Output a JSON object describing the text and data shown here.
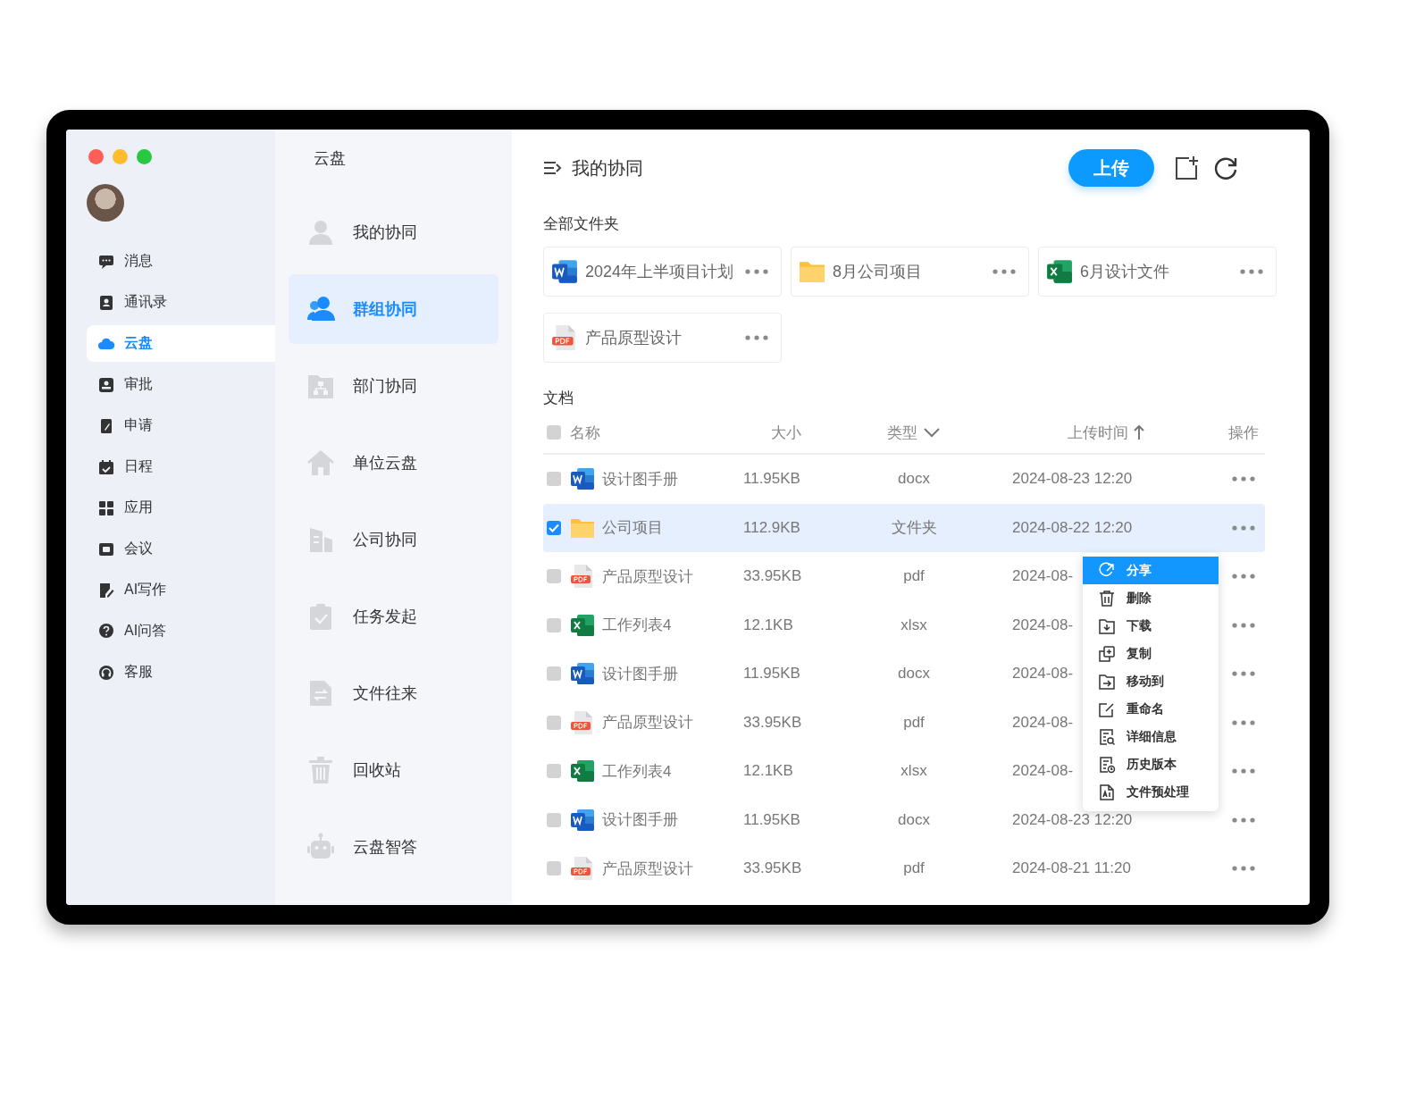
{
  "nav": {
    "items": [
      {
        "label": "消息",
        "kind": "chat",
        "selected": false
      },
      {
        "label": "通讯录",
        "kind": "contacts",
        "selected": false
      },
      {
        "label": "云盘",
        "kind": "cloud",
        "selected": true
      },
      {
        "label": "审批",
        "kind": "stamp",
        "selected": false
      },
      {
        "label": "申请",
        "kind": "pen",
        "selected": false
      },
      {
        "label": "日程",
        "kind": "calendar",
        "selected": false
      },
      {
        "label": "应用",
        "kind": "grid",
        "selected": false
      },
      {
        "label": "会议",
        "kind": "video",
        "selected": false
      },
      {
        "label": "AI写作",
        "kind": "write",
        "selected": false
      },
      {
        "label": "AI问答",
        "kind": "question",
        "selected": false
      },
      {
        "label": "客服",
        "kind": "headset",
        "selected": false
      }
    ]
  },
  "panel": {
    "title": "云盘",
    "items": [
      {
        "label": "我的协同",
        "kind": "person",
        "selected": false
      },
      {
        "label": "群组协同",
        "kind": "people",
        "selected": true
      },
      {
        "label": "部门协同",
        "kind": "org",
        "selected": false
      },
      {
        "label": "单位云盘",
        "kind": "house",
        "selected": false
      },
      {
        "label": "公司协同",
        "kind": "building",
        "selected": false
      },
      {
        "label": "任务发起",
        "kind": "clipboard",
        "selected": false
      },
      {
        "label": "文件往来",
        "kind": "exchange",
        "selected": false
      },
      {
        "label": "回收站",
        "kind": "trash",
        "selected": false
      },
      {
        "label": "云盘智答",
        "kind": "robot",
        "selected": false
      }
    ]
  },
  "main": {
    "title": "我的协同",
    "upload_button": "上传",
    "folders_heading": "全部文件夹",
    "folders": [
      {
        "name": "2024年上半项目计划",
        "kind": "word"
      },
      {
        "name": "8月公司项目",
        "kind": "folder"
      },
      {
        "name": "6月设计文件",
        "kind": "excel"
      },
      {
        "name": "产品原型设计",
        "kind": "pdf"
      }
    ],
    "docs_heading": "文档",
    "columns": [
      "名称",
      "大小",
      "类型",
      "上传时间",
      "操作"
    ],
    "header_checked": false,
    "rows": [
      {
        "name": "设计图手册",
        "size": "11.95KB",
        "type": "docx",
        "date": "2024-08-23 12:20",
        "kind": "word",
        "checked": false
      },
      {
        "name": "公司项目",
        "size": "112.9KB",
        "type": "文件夹",
        "date": "2024-08-22 12:20",
        "kind": "folder",
        "checked": true
      },
      {
        "name": "产品原型设计",
        "size": "33.95KB",
        "type": "pdf",
        "date": "2024-08-",
        "kind": "pdf",
        "checked": false
      },
      {
        "name": "工作列表4",
        "size": "12.1KB",
        "type": "xlsx",
        "date": "2024-08-",
        "kind": "excel",
        "checked": false
      },
      {
        "name": "设计图手册",
        "size": "11.95KB",
        "type": "docx",
        "date": "2024-08-",
        "kind": "word",
        "checked": false
      },
      {
        "name": "产品原型设计",
        "size": "33.95KB",
        "type": "pdf",
        "date": "2024-08-",
        "kind": "pdf",
        "checked": false
      },
      {
        "name": "工作列表4",
        "size": "12.1KB",
        "type": "xlsx",
        "date": "2024-08-",
        "kind": "excel",
        "checked": false
      },
      {
        "name": "设计图手册",
        "size": "11.95KB",
        "type": "docx",
        "date": "2024-08-23 12:20",
        "kind": "word",
        "checked": false
      },
      {
        "name": "产品原型设计",
        "size": "33.95KB",
        "type": "pdf",
        "date": "2024-08-21 11:20",
        "kind": "pdf",
        "checked": false
      }
    ],
    "context_menu": {
      "items": [
        {
          "label": "分享",
          "kind": "share",
          "selected": true
        },
        {
          "label": "删除",
          "kind": "trash",
          "selected": false
        },
        {
          "label": "下载",
          "kind": "download",
          "selected": false
        },
        {
          "label": "复制",
          "kind": "copy",
          "selected": false
        },
        {
          "label": "移动到",
          "kind": "move",
          "selected": false
        },
        {
          "label": "重命名",
          "kind": "rename",
          "selected": false
        },
        {
          "label": "详细信息",
          "kind": "details",
          "selected": false
        },
        {
          "label": "历史版本",
          "kind": "history",
          "selected": false
        },
        {
          "label": "文件预处理",
          "kind": "ai",
          "selected": false
        }
      ]
    }
  }
}
